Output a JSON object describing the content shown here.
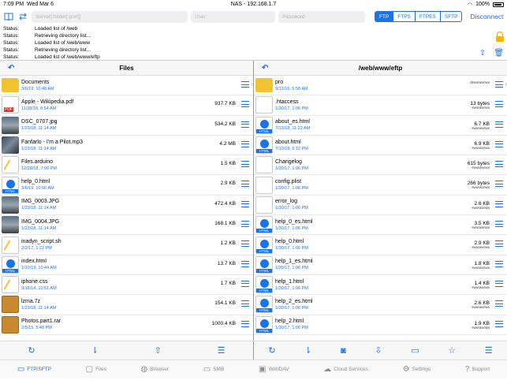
{
  "status_bar": {
    "time": "7:09 PM",
    "date": "Wed Mar 6",
    "title": "NAS - 192.168.1.7",
    "battery": "100%"
  },
  "connection": {
    "server_placeholder": "Server[:folder[:port]]",
    "user_placeholder": "User",
    "password_placeholder": "Password",
    "protocols": [
      "FTP",
      "FTPS",
      "FTPES",
      "SFTP"
    ],
    "active_protocol": "FTP",
    "connect_label": "Disconnect"
  },
  "log": [
    {
      "label": "Status:",
      "text": "Loaded list of /web"
    },
    {
      "label": "Status:",
      "text": "Retrieving directory list..."
    },
    {
      "label": "Status:",
      "text": "Loaded list of /web/www"
    },
    {
      "label": "Status:",
      "text": "Retrieving directory list..."
    },
    {
      "label": "Status:",
      "text": "Loaded list of /web/www/eftp"
    }
  ],
  "left_pane": {
    "title": "Files",
    "items": [
      {
        "name": "Documents",
        "date": "3/6/19, 10:48 AM",
        "size": "",
        "kind": "folder"
      },
      {
        "name": "Apple - Wikipedia.pdf",
        "date": "11/28/18, 8:54 AM",
        "size": "937.7 KB",
        "kind": "pdf"
      },
      {
        "name": "DSC_0707.jpg",
        "date": "1/23/18, 11:14 AM",
        "size": "534.2 KB",
        "kind": "photo"
      },
      {
        "name": "Fanfarlo - I'm a Pilot.mp3",
        "date": "1/23/18, 11:14 AM",
        "size": "4.2 MB",
        "kind": "audio"
      },
      {
        "name": "Files.arduino",
        "date": "12/28/18, 7:06 PM",
        "size": "1.5 KB",
        "kind": "text"
      },
      {
        "name": "help_0.html",
        "date": "3/6/19, 10:56 AM",
        "size": "2.9 KB",
        "kind": "html"
      },
      {
        "name": "IMG_0003.JPG",
        "date": "1/23/18, 11:14 AM",
        "size": "472.4 KB",
        "kind": "photo"
      },
      {
        "name": "IMG_0004.JPG",
        "date": "1/23/18, 11:14 AM",
        "size": "168.1 KB",
        "kind": "photo"
      },
      {
        "name": "inadyn_script.sh",
        "date": "2/2/17, 1:22 PM",
        "size": "1.2 KB",
        "kind": "text"
      },
      {
        "name": "index.html",
        "date": "1/10/19, 10:44 AM",
        "size": "13.7 KB",
        "kind": "html"
      },
      {
        "name": "iphone.css",
        "date": "9/18/14, 10:51 AM",
        "size": "1.7 KB",
        "kind": "text"
      },
      {
        "name": "lzma.7z",
        "date": "1/23/18, 11:14 AM",
        "size": "154.1 KB",
        "kind": "box"
      },
      {
        "name": "Photos.part1.rar",
        "date": "2/5/15, 5:48 PM",
        "size": "1000.4 KB",
        "kind": "box"
      }
    ]
  },
  "right_pane": {
    "title": "/web/www/eftp",
    "items": [
      {
        "name": "pro",
        "date": "9/12/16, 5:58 AM",
        "size": "",
        "perm": "drwxrwxrwx",
        "kind": "folder"
      },
      {
        "name": ".htaccess",
        "date": "1/30/17, 1:06 PM",
        "size": "13 bytes",
        "perm": "-rwxrwxrwx",
        "kind": "gen"
      },
      {
        "name": "about_es.html",
        "date": "7/13/18, 11:22 AM",
        "size": "6.7 KB",
        "perm": "-rwxrwxrwx",
        "kind": "html"
      },
      {
        "name": "about.html",
        "date": "7/10/18, 6:12 PM",
        "size": "6.9 KB",
        "perm": "-rwxrwxrwx",
        "kind": "html"
      },
      {
        "name": "Changelog",
        "date": "1/30/17, 1:06 PM",
        "size": "615 bytes",
        "perm": "-rwxrwxrwx",
        "kind": "gen"
      },
      {
        "name": "config.plist",
        "date": "1/30/17, 1:06 PM",
        "size": "266 bytes",
        "perm": "-rwxrwxrwx",
        "kind": "gen"
      },
      {
        "name": "error_log",
        "date": "1/30/17, 1:06 PM",
        "size": "2.6 KB",
        "perm": "-rwxrwxrwx",
        "kind": "gen"
      },
      {
        "name": "help_0_es.html",
        "date": "1/30/17, 1:06 PM",
        "size": "3.5 KB",
        "perm": "-rwxrwxrwx",
        "kind": "html"
      },
      {
        "name": "help_0.html",
        "date": "1/30/17, 1:06 PM",
        "size": "2.9 KB",
        "perm": "-rwxrwxrwx",
        "kind": "html"
      },
      {
        "name": "help_1_es.html",
        "date": "1/30/17, 1:06 PM",
        "size": "1.8 KB",
        "perm": "-rwxrwxrwx",
        "kind": "html"
      },
      {
        "name": "help_1.html",
        "date": "1/30/17, 1:06 PM",
        "size": "1.4 KB",
        "perm": "-rwxrwxrwx",
        "kind": "html"
      },
      {
        "name": "help_2_es.html",
        "date": "1/30/17, 1:06 PM",
        "size": "2.6 KB",
        "perm": "-rwxrwxrwx",
        "kind": "html"
      },
      {
        "name": "help_2.html",
        "date": "1/30/17, 1:06 PM",
        "size": "1.9 KB",
        "perm": "-rwxrwxrwx",
        "kind": "html"
      }
    ]
  },
  "tabs": [
    {
      "label": "FTP/SFTP",
      "icon": "computer-icon",
      "active": true
    },
    {
      "label": "Files",
      "icon": "folder-icon",
      "active": false
    },
    {
      "label": "Browser",
      "icon": "globe-icon",
      "active": false
    },
    {
      "label": "SMB",
      "icon": "monitor-icon",
      "active": false
    },
    {
      "label": "WebDAV",
      "icon": "webdav-icon",
      "active": false
    },
    {
      "label": "Cloud Services",
      "icon": "cloud-icon",
      "active": false
    },
    {
      "label": "Settings",
      "icon": "gear-icon",
      "active": false
    },
    {
      "label": "Support",
      "icon": "question-icon",
      "active": false
    }
  ],
  "colors": {
    "accent": "#1a73e8",
    "lock": "#f2b705"
  }
}
